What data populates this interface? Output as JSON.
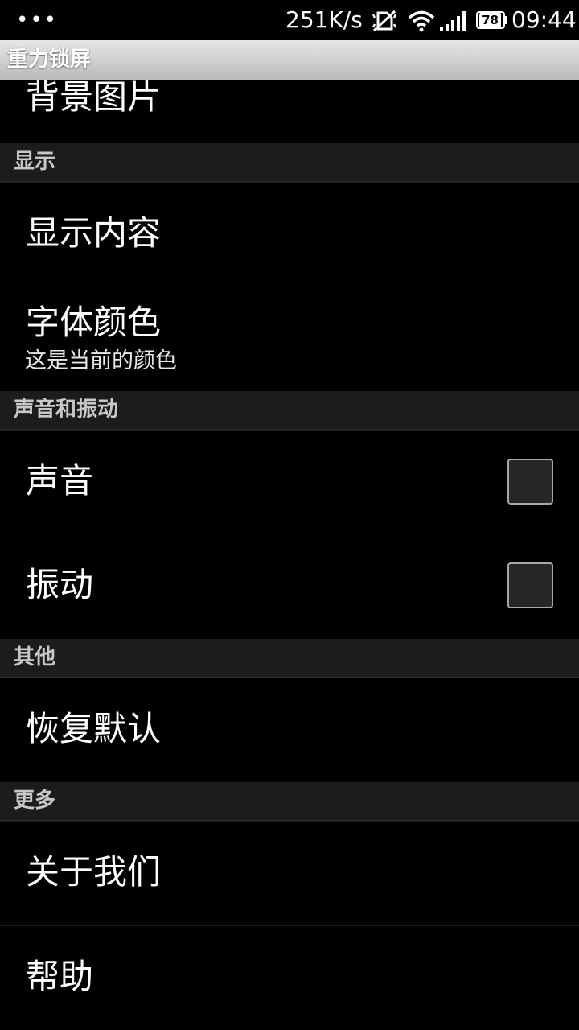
{
  "status_bar": {
    "dots": "•••",
    "speed": "251K/s",
    "battery": "78",
    "time": "09:44",
    "icons": [
      "silent-mode-icon",
      "wifi-icon",
      "signal-icon",
      "battery-icon"
    ],
    "color": "#ffffff"
  },
  "title_bar": {
    "title": "重力锁屏",
    "background": "#d0d0d0"
  },
  "list": {
    "background_image_item": {
      "title": "背景图片"
    },
    "display_category": {
      "label": "显示"
    },
    "display_content": {
      "title": "显示内容"
    },
    "font_color": {
      "title": "字体颜色",
      "summary": "这是当前的颜色"
    },
    "sound_vibration_category": {
      "label": "声音和振动"
    },
    "sound": {
      "title": "声音",
      "checked": false
    },
    "vibration": {
      "title": "振动",
      "checked": false
    },
    "other_category": {
      "label": "其他"
    },
    "restore_defaults": {
      "title": "恢复默认"
    },
    "more_category": {
      "label": "更多"
    },
    "about_us": {
      "title": "关于我们"
    },
    "help": {
      "title": "帮助"
    }
  }
}
